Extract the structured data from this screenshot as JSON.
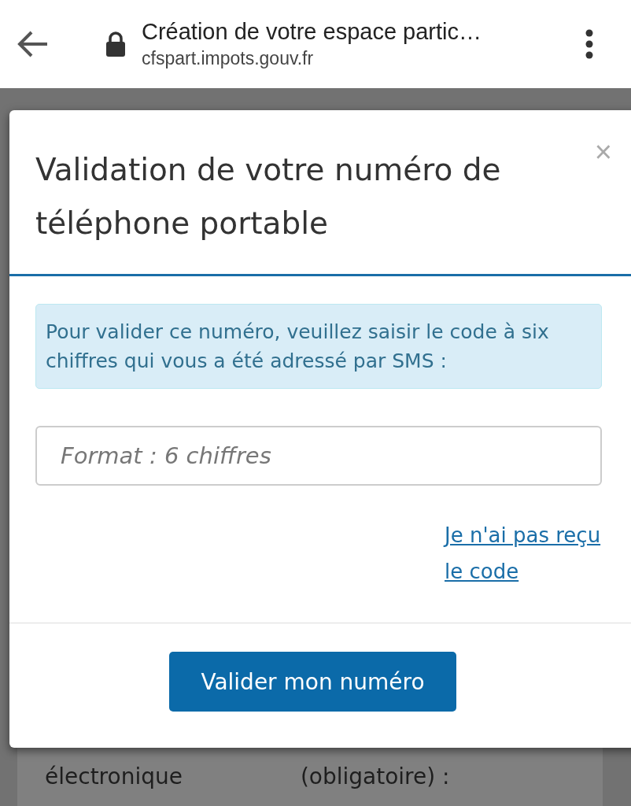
{
  "browser": {
    "title": "Création de votre espace partic…",
    "url": "cfspart.impots.gouv.fr"
  },
  "background_form": {
    "labels": [
      "électronique",
      "(obligatoire) :"
    ]
  },
  "modal": {
    "title": "Validation de votre numéro de téléphone portable",
    "close": "×",
    "info": "Pour valider ce numéro, veuillez saisir le code à six chiffres qui vous a été adressé par SMS :",
    "code_field": {
      "placeholder": "Format : 6 chiffres"
    },
    "link": "Je n'ai pas reçu le code",
    "button": "Valider mon numéro"
  }
}
